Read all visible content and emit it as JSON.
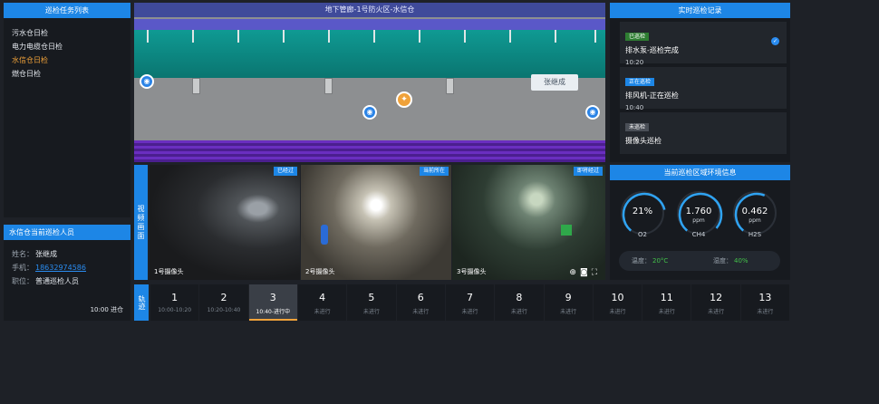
{
  "task_list": {
    "title": "巡检任务列表",
    "items": [
      "污水仓日检",
      "电力电缆仓日检",
      "水信仓日检",
      "燃仓日检"
    ],
    "active_index": 2
  },
  "inspector": {
    "title": "水信仓当前巡检人员",
    "name_label": "姓名：",
    "name": "张继成",
    "phone_label": "手机：",
    "phone": "18632974586",
    "role_label": "职位：",
    "role": "普通巡检人员",
    "footer": "10:00 进仓"
  },
  "map": {
    "title": "地下管廊-1号防火区-水信仓",
    "person_label": "张继成"
  },
  "video": {
    "label": "视频画面",
    "cameras": [
      {
        "caption": "1号摄像头",
        "badge": "已经过"
      },
      {
        "caption": "2号摄像头",
        "badge": "当前所在"
      },
      {
        "caption": "3号摄像头",
        "badge": "即将经过"
      }
    ],
    "tools": [
      "zoom-icon",
      "camera-icon",
      "fullscreen-icon"
    ]
  },
  "track": {
    "label": "轨迹",
    "steps": [
      {
        "n": "1",
        "t": "10:00-10:20"
      },
      {
        "n": "2",
        "t": "10:20-10:40"
      },
      {
        "n": "3",
        "t": "10:40-进行中"
      },
      {
        "n": "4",
        "t": "未进行"
      },
      {
        "n": "5",
        "t": "未进行"
      },
      {
        "n": "6",
        "t": "未进行"
      },
      {
        "n": "7",
        "t": "未进行"
      },
      {
        "n": "8",
        "t": "未进行"
      },
      {
        "n": "9",
        "t": "未进行"
      },
      {
        "n": "10",
        "t": "未进行"
      },
      {
        "n": "11",
        "t": "未进行"
      },
      {
        "n": "12",
        "t": "未进行"
      },
      {
        "n": "13",
        "t": "未进行"
      }
    ],
    "current_index": 2
  },
  "records": {
    "title": "实时巡检记录",
    "items": [
      {
        "tag": "已巡检",
        "tag_color": "#2e7d32",
        "title": "排水泵-巡检完成",
        "time": "10:20",
        "done": true
      },
      {
        "tag": "正在巡检",
        "tag_color": "#1d86e6",
        "title": "排风机-正在巡检",
        "time": "10:40",
        "done": false
      },
      {
        "tag": "未巡检",
        "tag_color": "#4a4f57",
        "title": "摄像头巡检",
        "time": "",
        "done": false
      }
    ]
  },
  "environment": {
    "title": "当前巡检区域环境信息",
    "gauges": [
      {
        "value": "21%",
        "unit": "",
        "name": "O2",
        "fraction": 0.6
      },
      {
        "value": "1.760",
        "unit": "ppm",
        "name": "CH4",
        "fraction": 0.75
      },
      {
        "value": "0.462",
        "unit": "ppm",
        "name": "H2S",
        "fraction": 0.45
      }
    ],
    "temp_label": "温度：",
    "temp": "20°C",
    "humidity_label": "湿度：",
    "humidity": "40%"
  },
  "colors": {
    "accent": "#1d86e6",
    "active": "#f0a23a",
    "ok": "#43c24a"
  }
}
